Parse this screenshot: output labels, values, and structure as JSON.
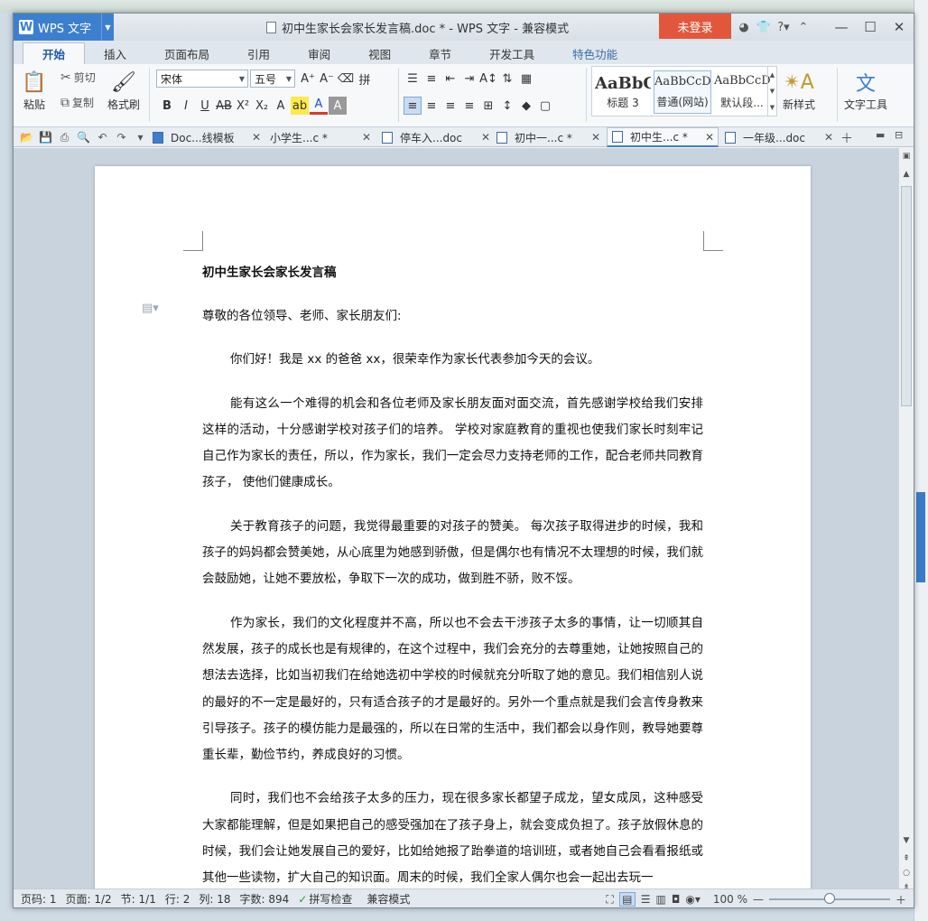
{
  "app": {
    "name": "WPS 文字",
    "window_title": "初中生家长会家长发言稿.doc * - WPS 文字 - 兼容模式",
    "login_label": "未登录"
  },
  "menu_tabs": [
    "开始",
    "插入",
    "页面布局",
    "引用",
    "审阅",
    "视图",
    "章节",
    "开发工具",
    "特色功能"
  ],
  "ribbon": {
    "paste": "粘贴",
    "cut": "剪切",
    "copy": "复制",
    "format_painter": "格式刷",
    "font_name": "宋体",
    "font_size": "五号",
    "styles": [
      {
        "preview": "AaBbC",
        "label": "标题 3"
      },
      {
        "preview": "AaBbCcDd",
        "label": "普通(网站)"
      },
      {
        "preview": "AaBbCcDd",
        "label": "默认段..."
      }
    ],
    "new_style": "新样式",
    "text_tools": "文字工具"
  },
  "doc_tabs": [
    {
      "label": "Doc...线模板",
      "active": false
    },
    {
      "label": "小学生...c *",
      "active": false
    },
    {
      "label": "停车入...doc",
      "active": false
    },
    {
      "label": "初中一...c *",
      "active": false
    },
    {
      "label": "初中生...c *",
      "active": true
    },
    {
      "label": "一年级...doc",
      "active": false
    }
  ],
  "document": {
    "title": "初中生家长会家长发言稿",
    "salutation": "尊敬的各位领导、老师、家长朋友们:",
    "paragraphs": [
      "你们好！我是 xx 的爸爸 xx，很荣幸作为家长代表参加今天的会议。",
      "能有这么一个难得的机会和各位老师及家长朋友面对面交流，首先感谢学校给我们安排这样的活动，十分感谢学校对孩子们的培养。 学校对家庭教育的重视也使我们家长时刻牢记自己作为家长的责任，所以，作为家长，我们一定会尽力支持老师的工作，配合老师共同教育孩子， 使他们健康成长。",
      "关于教育孩子的问题，我觉得最重要的对孩子的赞美。 每次孩子取得进步的时候，我和孩子的妈妈都会赞美她，从心底里为她感到骄傲，但是偶尔也有情况不太理想的时候，我们就会鼓励她，让她不要放松，争取下一次的成功，做到胜不骄，败不馁。",
      "作为家长，我们的文化程度并不高，所以也不会去干涉孩子太多的事情，让一切顺其自然发展，孩子的成长也是有规律的，在这个过程中，我们会充分的去尊重她，让她按照自己的想法去选择，比如当初我们在给她选初中学校的时候就充分听取了她的意见。我们相信别人说的最好的不一定是最好的，只有适合孩子的才是最好的。另外一个重点就是我们会言传身教来引导孩子。孩子的模仿能力是最强的，所以在日常的生活中，我们都会以身作则，教导她要尊重长辈，勤俭节约，养成良好的习惯。",
      "同时，我们也不会给孩子太多的压力，现在很多家长都望子成龙，望女成凤，这种感受大家都能理解，但是如果把自己的感受强加在了孩子身上，就会变成负担了。孩子放假休息的时候，我们会让她发展自己的爱好，比如给她报了跆拳道的培训班，或者她自己会看看报纸或其他一些读物，扩大自己的知识面。周末的时候，我们全家人偶尔也会一起出去玩一"
    ]
  },
  "status": {
    "page_num": "页码: 1",
    "pages": "页面: 1/2",
    "section": "节: 1/1",
    "row": "行: 2",
    "col": "列: 18",
    "word_count": "字数: 894",
    "spell_check": "拼写检查",
    "mode": "兼容模式",
    "zoom": "100 %",
    "zoom_fraction": 0.5
  },
  "colors": {
    "accent": "#3d7fcf",
    "login": "#e2573c"
  }
}
